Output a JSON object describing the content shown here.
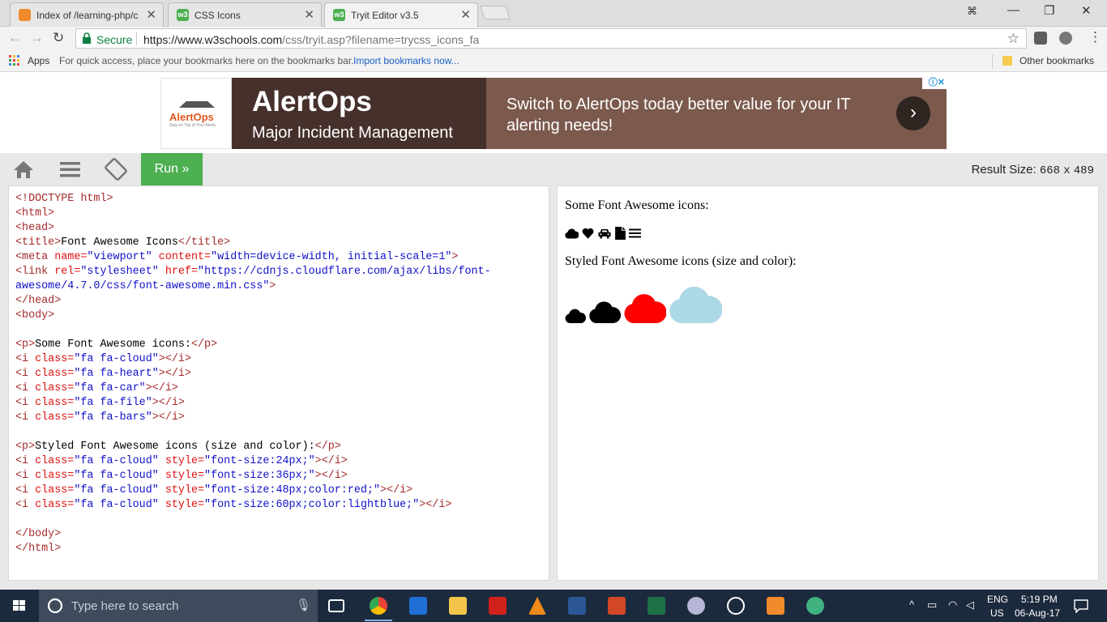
{
  "browser": {
    "tabs": [
      {
        "title": "Index of /learning-php/c",
        "icon": "xampp-icon"
      },
      {
        "title": "CSS Icons",
        "icon": "w3schools-icon"
      },
      {
        "title": "Tryit Editor v3.5",
        "icon": "w3schools-icon"
      }
    ],
    "secure_label": "Secure",
    "url_host": "https://www.w3schools.com",
    "url_path": "/css/tryit.asp?filename=trycss_icons_fa",
    "bookmarks": {
      "apps_label": "Apps",
      "quick_access": "For quick access, place your bookmarks here on the bookmarks bar.",
      "import_link": "Import bookmarks now...",
      "other": "Other bookmarks"
    }
  },
  "ad": {
    "logo_word": "AlertOps",
    "logo_tag": "Stay on Top of Your Alerts",
    "brand": "AlertOps",
    "subtitle": "Major Incident Management",
    "message": "Switch to AlertOps today better value for your IT alerting needs!",
    "arrow": "›",
    "badge": "ⓘ✕"
  },
  "tryit": {
    "run_label": "Run »",
    "result_size_label": "Result Size:",
    "result_width": "668",
    "result_x": "x",
    "result_height": "489",
    "code_lines": [
      [
        [
          "tg",
          "<!DOCTYPE html>"
        ]
      ],
      [
        [
          "tg",
          "<html>"
        ]
      ],
      [
        [
          "tg",
          "<head>"
        ]
      ],
      [
        [
          "tg",
          "<title>"
        ],
        [
          "tx",
          "Font Awesome Icons"
        ],
        [
          "tg",
          "</title>"
        ]
      ],
      [
        [
          "tg",
          "<meta "
        ],
        [
          "at",
          "name="
        ],
        [
          "vl",
          "\"viewport\""
        ],
        [
          "at",
          " content="
        ],
        [
          "vl",
          "\"width=device-width, initial-scale=1\""
        ],
        [
          "tg",
          ">"
        ]
      ],
      [
        [
          "tg",
          "<link "
        ],
        [
          "at",
          "rel="
        ],
        [
          "vl",
          "\"stylesheet\""
        ],
        [
          "at",
          " href="
        ],
        [
          "vl",
          "\"https://cdnjs.cloudflare.com/ajax/libs/font-"
        ]
      ],
      [
        [
          "vl",
          "awesome/4.7.0/css/font-awesome.min.css\""
        ],
        [
          "tg",
          ">"
        ]
      ],
      [
        [
          "tg",
          "</head>"
        ]
      ],
      [
        [
          "tg",
          "<body>"
        ]
      ],
      [],
      [
        [
          "tg",
          "<p>"
        ],
        [
          "tx",
          "Some Font Awesome icons:"
        ],
        [
          "tg",
          "</p>"
        ]
      ],
      [
        [
          "tg",
          "<i "
        ],
        [
          "at",
          "class="
        ],
        [
          "vl",
          "\"fa fa-cloud\""
        ],
        [
          "tg",
          "></i>"
        ]
      ],
      [
        [
          "tg",
          "<i "
        ],
        [
          "at",
          "class="
        ],
        [
          "vl",
          "\"fa fa-heart\""
        ],
        [
          "tg",
          "></i>"
        ]
      ],
      [
        [
          "tg",
          "<i "
        ],
        [
          "at",
          "class="
        ],
        [
          "vl",
          "\"fa fa-car\""
        ],
        [
          "tg",
          "></i>"
        ]
      ],
      [
        [
          "tg",
          "<i "
        ],
        [
          "at",
          "class="
        ],
        [
          "vl",
          "\"fa fa-file\""
        ],
        [
          "tg",
          "></i>"
        ]
      ],
      [
        [
          "tg",
          "<i "
        ],
        [
          "at",
          "class="
        ],
        [
          "vl",
          "\"fa fa-bars\""
        ],
        [
          "tg",
          "></i>"
        ]
      ],
      [],
      [
        [
          "tg",
          "<p>"
        ],
        [
          "tx",
          "Styled Font Awesome icons (size and color):"
        ],
        [
          "tg",
          "</p>"
        ]
      ],
      [
        [
          "tg",
          "<i "
        ],
        [
          "at",
          "class="
        ],
        [
          "vl",
          "\"fa fa-cloud\""
        ],
        [
          "at",
          " style="
        ],
        [
          "vl",
          "\"font-size:24px;\""
        ],
        [
          "tg",
          "></i>"
        ]
      ],
      [
        [
          "tg",
          "<i "
        ],
        [
          "at",
          "class="
        ],
        [
          "vl",
          "\"fa fa-cloud\""
        ],
        [
          "at",
          " style="
        ],
        [
          "vl",
          "\"font-size:36px;\""
        ],
        [
          "tg",
          "></i>"
        ]
      ],
      [
        [
          "tg",
          "<i "
        ],
        [
          "at",
          "class="
        ],
        [
          "vl",
          "\"fa fa-cloud\""
        ],
        [
          "at",
          " style="
        ],
        [
          "vl",
          "\"font-size:48px;color:red;\""
        ],
        [
          "tg",
          "></i>"
        ]
      ],
      [
        [
          "tg",
          "<i "
        ],
        [
          "at",
          "class="
        ],
        [
          "vl",
          "\"fa fa-cloud\""
        ],
        [
          "at",
          " style="
        ],
        [
          "vl",
          "\"font-size:60px;color:lightblue;\""
        ],
        [
          "tg",
          "></i>"
        ]
      ],
      [],
      [
        [
          "tg",
          "</body>"
        ]
      ],
      [
        [
          "tg",
          "</html>"
        ]
      ]
    ]
  },
  "result": {
    "heading1": "Some Font Awesome icons:",
    "heading2": "Styled Font Awesome icons (size and color):",
    "icons": [
      "cloud-icon",
      "heart-icon",
      "car-icon",
      "file-icon",
      "bars-icon"
    ],
    "styled_clouds": [
      {
        "size": "24px",
        "color": "#000000"
      },
      {
        "size": "36px",
        "color": "#000000"
      },
      {
        "size": "48px",
        "color": "#ff0000"
      },
      {
        "size": "60px",
        "color": "#add8e6"
      }
    ]
  },
  "taskbar": {
    "search_placeholder": "Type here to search",
    "lang_top": "ENG",
    "lang_bottom": "US",
    "time": "5:19 PM",
    "date": "06-Aug-17"
  },
  "colors": {
    "run_green": "#4caf50",
    "ad_dark": "#45302b",
    "ad_brown": "#7b5a4d",
    "taskbar": "#1c2a3d"
  }
}
